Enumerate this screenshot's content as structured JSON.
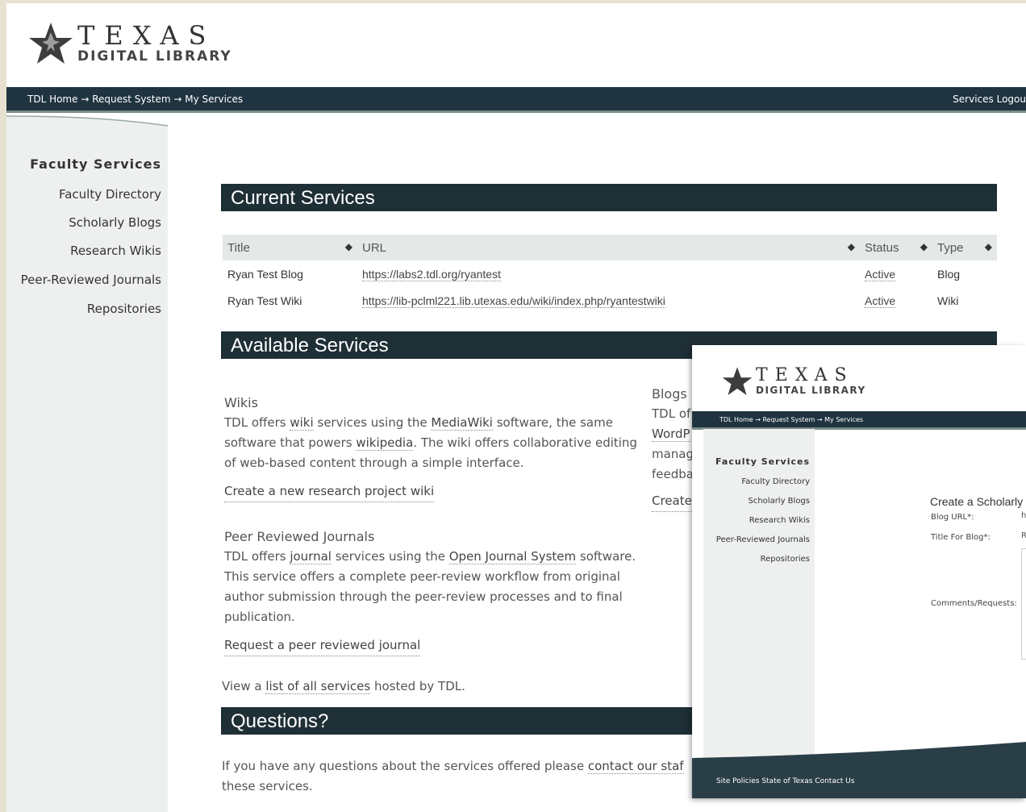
{
  "logo": {
    "word1": "TEXAS",
    "word2": "DIGITAL LIBRARY"
  },
  "nav": {
    "crumbs": [
      "TDL Home",
      "Request System",
      "My Services"
    ],
    "separator": "→",
    "right": [
      "Services",
      "Logou"
    ]
  },
  "sidebar": {
    "title": "Faculty Services",
    "items": [
      "Faculty Directory",
      "Scholarly Blogs",
      "Research Wikis",
      "Peer-Reviewed Journals",
      "Repositories"
    ]
  },
  "current": {
    "heading": "Current Services",
    "columns": [
      "Title",
      "URL",
      "Status",
      "Type"
    ],
    "rows": [
      {
        "title": "Ryan Test Blog",
        "url": "https://labs2.tdl.org/ryantest",
        "status": "Active",
        "type": "Blog"
      },
      {
        "title": "Ryan Test Wiki",
        "url": "https://lib-pclml221.lib.utexas.edu/wiki/index.php/ryantestwiki",
        "status": "Active",
        "type": "Wiki"
      }
    ]
  },
  "available": {
    "heading": "Available Services",
    "wikis": {
      "title": "Wikis",
      "t1": "TDL offers ",
      "l1": "wiki",
      "t2": " services using the ",
      "l2": "MediaWiki",
      "t3": " software, the same software that powers ",
      "l3": "wikipedia",
      "t4": ". The wiki offers collaborative editing of web-based content through a simple interface.",
      "cta": "Create a new research project wiki"
    },
    "journals": {
      "title": "Peer Reviewed Journals",
      "t1": "TDL offers ",
      "l1": "journal",
      "t2": " services using the ",
      "l2": "Open Journal System",
      "t3": " software. This service offers a complete peer-review workflow from original author submission through the peer-review processes and to final publication.",
      "cta": "Request a peer reviewed journal"
    },
    "blogs": {
      "title": "Blogs",
      "lines": [
        "TDL of",
        "WordP",
        "manag",
        "feedba"
      ],
      "cta": "Create"
    },
    "list": {
      "t1": "View a ",
      "link": "list of all services",
      "t2": " hosted by TDL."
    }
  },
  "questions": {
    "heading": "Questions?",
    "t1": "If you have any questions about the services offered please ",
    "link": "contact our staf",
    "t2": "these services."
  },
  "popup": {
    "nav_crumbs": [
      "TDL Home",
      "Request System",
      "My Services"
    ],
    "sidebar_title": "Faculty Services",
    "sidebar_items": [
      "Faculty Directory",
      "Scholarly Blogs",
      "Research Wikis",
      "Peer-Reviewed Journals",
      "Repositories"
    ],
    "form_title": "Create a Scholarly",
    "blog_url_label": "Blog URL*:",
    "blog_url_value": "h",
    "title_label": "Title For Blog*:",
    "title_value": "R",
    "comments_label": "Comments/Requests:",
    "footer": [
      "Site Policies",
      "State of Texas",
      "Contact Us"
    ]
  }
}
